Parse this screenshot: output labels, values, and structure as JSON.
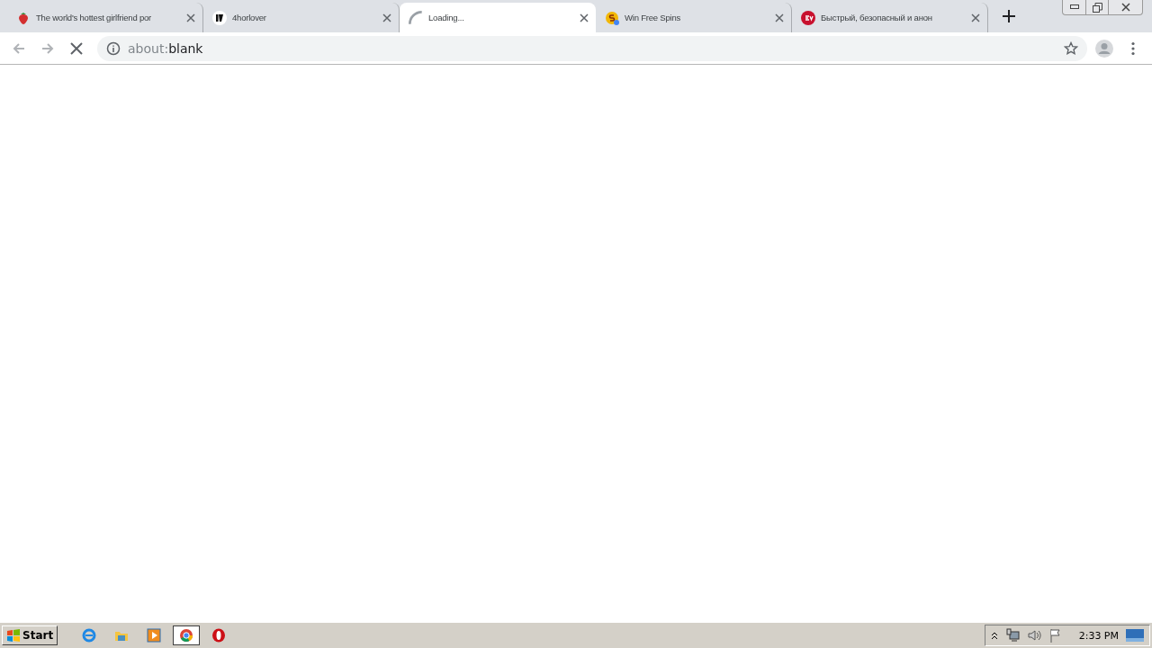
{
  "tabs": [
    {
      "title": "The world's hottest girlfriend por",
      "kind": "strawberry",
      "selected": false,
      "notified": false
    },
    {
      "title": "4horlover",
      "kind": "mark",
      "selected": false,
      "notified": false
    },
    {
      "title": "Loading...",
      "kind": "spinner",
      "selected": true,
      "notified": false
    },
    {
      "title": "Win Free Spins",
      "kind": "coin",
      "selected": false,
      "notified": true
    },
    {
      "title": "Быстрый, безопасный и анон",
      "kind": "shield",
      "selected": false,
      "notified": false
    }
  ],
  "toolbar": {
    "back_disabled": true,
    "forward_disabled": true,
    "address": {
      "scheme": "about:",
      "rest": "blank"
    }
  },
  "taskbar": {
    "start": "Start",
    "apps": [
      {
        "kind": "ie",
        "selected": false
      },
      {
        "kind": "folder",
        "selected": false
      },
      {
        "kind": "media",
        "selected": false
      },
      {
        "kind": "chrome",
        "selected": true
      },
      {
        "kind": "opera",
        "selected": false
      }
    ],
    "clock": "2:33 PM"
  }
}
